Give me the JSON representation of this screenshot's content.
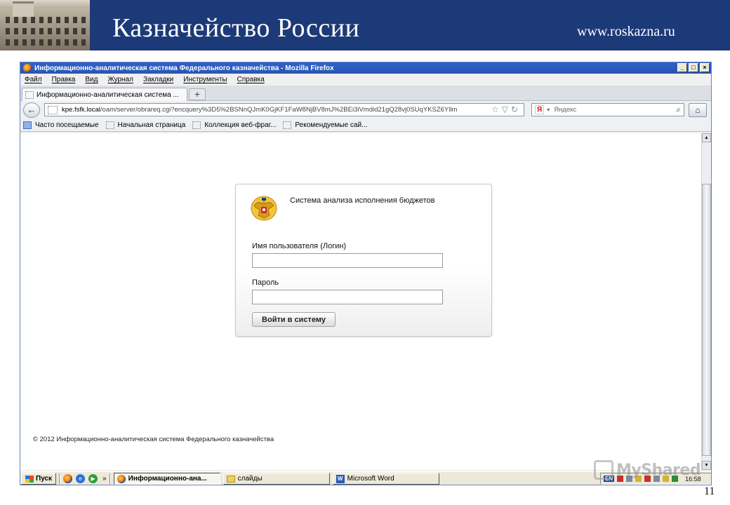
{
  "slide": {
    "title": "Казначейство России",
    "url": "www.roskazna.ru",
    "page_number": "11"
  },
  "window": {
    "title": "Информационно-аналитическая система Федерального казначейства - Mozilla Firefox",
    "buttons": [
      "_",
      "□",
      "×"
    ]
  },
  "menu": {
    "items": [
      "Файл",
      "Правка",
      "Вид",
      "Журнал",
      "Закладки",
      "Инструменты",
      "Справка"
    ]
  },
  "tabs": {
    "active_label": "Информационно-аналитическая система ...",
    "new_tab_label": "+"
  },
  "nav": {
    "url_host": "kpe.fsfk.local",
    "url_path": "/oam/server/obrareq.cgi?encquery%3D5%2BSNnQJmK0GjKF1FaW8NjBV8mJ%2BEi3iVmdid21gQ28vj0SUqYKSZ6Yllm",
    "search_placeholder": "Яндекс",
    "search_engine_badge": "Я"
  },
  "bookmarks": {
    "items": [
      "Часто посещаемые",
      "Начальная страница",
      "Коллекция веб-фраг...",
      "Рекомендуемые сай..."
    ]
  },
  "login": {
    "system_title": "Система анализа исполнения бюджетов",
    "username_label": "Имя пользователя (Логин)",
    "username_value": "",
    "password_label": "Пароль",
    "password_value": "",
    "submit_label": "Войти в систему"
  },
  "footer": {
    "copyright": "© 2012 Информационно-аналитическая система Федерального казначейства"
  },
  "taskbar": {
    "start_label": "Пуск",
    "quick_launch_more": "»",
    "tasks": [
      "Информационно-ана...",
      "слайды",
      "Microsoft Word"
    ],
    "language": "EN",
    "clock": "16:58"
  },
  "watermark": {
    "text": "MyShared"
  },
  "colors": {
    "banner": "#1d3a78",
    "titlebar": "#2f62c8",
    "taskbar": "#ece9d8"
  }
}
